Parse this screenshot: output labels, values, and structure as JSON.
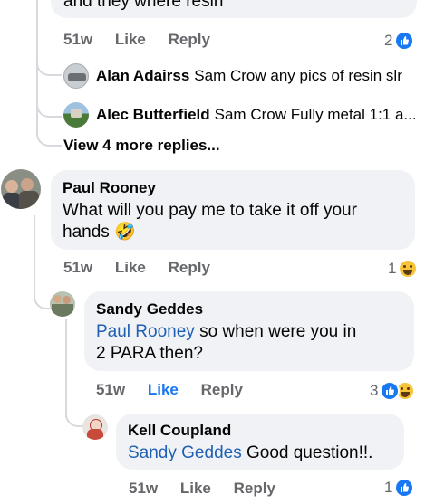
{
  "top_comment": {
    "partial_text": "and they where resin",
    "time": "51w",
    "like_label": "Like",
    "reply_label": "Reply",
    "reaction_count": "2"
  },
  "collapsed_replies": [
    {
      "author": "Alan Adairss",
      "preview": "Sam Crow  any pics of resin slr"
    },
    {
      "author": "Alec Butterfield",
      "preview": "Sam Crow Fully metal 1:1 a..."
    }
  ],
  "view_more_label": "View 4 more replies...",
  "comment_paul": {
    "author": "Paul Rooney",
    "text": "What will you pay me to take it off your hands",
    "emoji": "🤣",
    "time": "51w",
    "like_label": "Like",
    "reply_label": "Reply",
    "reaction_count": "1"
  },
  "reply_sandy": {
    "author": "Sandy Geddes",
    "mention": "Paul Rooney",
    "text": " so when were you in 2 PARA then?",
    "time": "51w",
    "like_label": "Like",
    "reply_label": "Reply",
    "reaction_count": "3"
  },
  "reply_kell": {
    "author": "Kell Coupland",
    "mention": "Sandy Geddes",
    "text": " Good question!!.",
    "time": "51w",
    "like_label": "Like",
    "reply_label": "Reply",
    "reaction_count": "1"
  },
  "colors": {
    "link": "#1f5fb4",
    "like_blue": "#1877f2",
    "meta_gray": "#65676b",
    "bubble": "#f0f2f5"
  }
}
